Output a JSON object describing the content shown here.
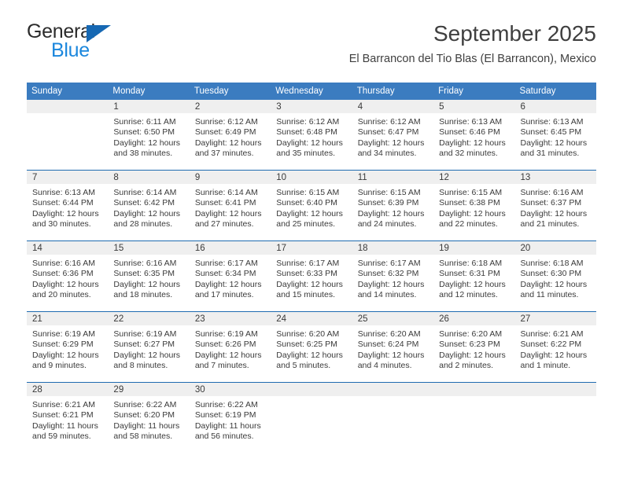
{
  "brand": {
    "line1": "General",
    "line2": "Blue",
    "triangle_color": "#1668b3",
    "blue_text_color": "#1b87dd"
  },
  "header": {
    "month_title": "September 2025",
    "location": "El Barrancon del Tio Blas (El Barrancon), Mexico"
  },
  "theme": {
    "header_blue": "#3b7cc0",
    "separator_blue": "#1f6bb0",
    "daynum_band": "#efefef",
    "text": "#3a3a3a"
  },
  "calendar": {
    "weekday_headers": [
      "Sunday",
      "Monday",
      "Tuesday",
      "Wednesday",
      "Thursday",
      "Friday",
      "Saturday"
    ],
    "weeks": [
      [
        {
          "day": "",
          "sunrise": "",
          "sunset": "",
          "daylight_line1": "",
          "daylight_line2": "",
          "blank": true
        },
        {
          "day": "1",
          "sunrise": "Sunrise: 6:11 AM",
          "sunset": "Sunset: 6:50 PM",
          "daylight_line1": "Daylight: 12 hours",
          "daylight_line2": "and 38 minutes.",
          "blank": false
        },
        {
          "day": "2",
          "sunrise": "Sunrise: 6:12 AM",
          "sunset": "Sunset: 6:49 PM",
          "daylight_line1": "Daylight: 12 hours",
          "daylight_line2": "and 37 minutes.",
          "blank": false
        },
        {
          "day": "3",
          "sunrise": "Sunrise: 6:12 AM",
          "sunset": "Sunset: 6:48 PM",
          "daylight_line1": "Daylight: 12 hours",
          "daylight_line2": "and 35 minutes.",
          "blank": false
        },
        {
          "day": "4",
          "sunrise": "Sunrise: 6:12 AM",
          "sunset": "Sunset: 6:47 PM",
          "daylight_line1": "Daylight: 12 hours",
          "daylight_line2": "and 34 minutes.",
          "blank": false
        },
        {
          "day": "5",
          "sunrise": "Sunrise: 6:13 AM",
          "sunset": "Sunset: 6:46 PM",
          "daylight_line1": "Daylight: 12 hours",
          "daylight_line2": "and 32 minutes.",
          "blank": false
        },
        {
          "day": "6",
          "sunrise": "Sunrise: 6:13 AM",
          "sunset": "Sunset: 6:45 PM",
          "daylight_line1": "Daylight: 12 hours",
          "daylight_line2": "and 31 minutes.",
          "blank": false
        }
      ],
      [
        {
          "day": "7",
          "sunrise": "Sunrise: 6:13 AM",
          "sunset": "Sunset: 6:44 PM",
          "daylight_line1": "Daylight: 12 hours",
          "daylight_line2": "and 30 minutes.",
          "blank": false
        },
        {
          "day": "8",
          "sunrise": "Sunrise: 6:14 AM",
          "sunset": "Sunset: 6:42 PM",
          "daylight_line1": "Daylight: 12 hours",
          "daylight_line2": "and 28 minutes.",
          "blank": false
        },
        {
          "day": "9",
          "sunrise": "Sunrise: 6:14 AM",
          "sunset": "Sunset: 6:41 PM",
          "daylight_line1": "Daylight: 12 hours",
          "daylight_line2": "and 27 minutes.",
          "blank": false
        },
        {
          "day": "10",
          "sunrise": "Sunrise: 6:15 AM",
          "sunset": "Sunset: 6:40 PM",
          "daylight_line1": "Daylight: 12 hours",
          "daylight_line2": "and 25 minutes.",
          "blank": false
        },
        {
          "day": "11",
          "sunrise": "Sunrise: 6:15 AM",
          "sunset": "Sunset: 6:39 PM",
          "daylight_line1": "Daylight: 12 hours",
          "daylight_line2": "and 24 minutes.",
          "blank": false
        },
        {
          "day": "12",
          "sunrise": "Sunrise: 6:15 AM",
          "sunset": "Sunset: 6:38 PM",
          "daylight_line1": "Daylight: 12 hours",
          "daylight_line2": "and 22 minutes.",
          "blank": false
        },
        {
          "day": "13",
          "sunrise": "Sunrise: 6:16 AM",
          "sunset": "Sunset: 6:37 PM",
          "daylight_line1": "Daylight: 12 hours",
          "daylight_line2": "and 21 minutes.",
          "blank": false
        }
      ],
      [
        {
          "day": "14",
          "sunrise": "Sunrise: 6:16 AM",
          "sunset": "Sunset: 6:36 PM",
          "daylight_line1": "Daylight: 12 hours",
          "daylight_line2": "and 20 minutes.",
          "blank": false
        },
        {
          "day": "15",
          "sunrise": "Sunrise: 6:16 AM",
          "sunset": "Sunset: 6:35 PM",
          "daylight_line1": "Daylight: 12 hours",
          "daylight_line2": "and 18 minutes.",
          "blank": false
        },
        {
          "day": "16",
          "sunrise": "Sunrise: 6:17 AM",
          "sunset": "Sunset: 6:34 PM",
          "daylight_line1": "Daylight: 12 hours",
          "daylight_line2": "and 17 minutes.",
          "blank": false
        },
        {
          "day": "17",
          "sunrise": "Sunrise: 6:17 AM",
          "sunset": "Sunset: 6:33 PM",
          "daylight_line1": "Daylight: 12 hours",
          "daylight_line2": "and 15 minutes.",
          "blank": false
        },
        {
          "day": "18",
          "sunrise": "Sunrise: 6:17 AM",
          "sunset": "Sunset: 6:32 PM",
          "daylight_line1": "Daylight: 12 hours",
          "daylight_line2": "and 14 minutes.",
          "blank": false
        },
        {
          "day": "19",
          "sunrise": "Sunrise: 6:18 AM",
          "sunset": "Sunset: 6:31 PM",
          "daylight_line1": "Daylight: 12 hours",
          "daylight_line2": "and 12 minutes.",
          "blank": false
        },
        {
          "day": "20",
          "sunrise": "Sunrise: 6:18 AM",
          "sunset": "Sunset: 6:30 PM",
          "daylight_line1": "Daylight: 12 hours",
          "daylight_line2": "and 11 minutes.",
          "blank": false
        }
      ],
      [
        {
          "day": "21",
          "sunrise": "Sunrise: 6:19 AM",
          "sunset": "Sunset: 6:29 PM",
          "daylight_line1": "Daylight: 12 hours",
          "daylight_line2": "and 9 minutes.",
          "blank": false
        },
        {
          "day": "22",
          "sunrise": "Sunrise: 6:19 AM",
          "sunset": "Sunset: 6:27 PM",
          "daylight_line1": "Daylight: 12 hours",
          "daylight_line2": "and 8 minutes.",
          "blank": false
        },
        {
          "day": "23",
          "sunrise": "Sunrise: 6:19 AM",
          "sunset": "Sunset: 6:26 PM",
          "daylight_line1": "Daylight: 12 hours",
          "daylight_line2": "and 7 minutes.",
          "blank": false
        },
        {
          "day": "24",
          "sunrise": "Sunrise: 6:20 AM",
          "sunset": "Sunset: 6:25 PM",
          "daylight_line1": "Daylight: 12 hours",
          "daylight_line2": "and 5 minutes.",
          "blank": false
        },
        {
          "day": "25",
          "sunrise": "Sunrise: 6:20 AM",
          "sunset": "Sunset: 6:24 PM",
          "daylight_line1": "Daylight: 12 hours",
          "daylight_line2": "and 4 minutes.",
          "blank": false
        },
        {
          "day": "26",
          "sunrise": "Sunrise: 6:20 AM",
          "sunset": "Sunset: 6:23 PM",
          "daylight_line1": "Daylight: 12 hours",
          "daylight_line2": "and 2 minutes.",
          "blank": false
        },
        {
          "day": "27",
          "sunrise": "Sunrise: 6:21 AM",
          "sunset": "Sunset: 6:22 PM",
          "daylight_line1": "Daylight: 12 hours",
          "daylight_line2": "and 1 minute.",
          "blank": false
        }
      ],
      [
        {
          "day": "28",
          "sunrise": "Sunrise: 6:21 AM",
          "sunset": "Sunset: 6:21 PM",
          "daylight_line1": "Daylight: 11 hours",
          "daylight_line2": "and 59 minutes.",
          "blank": false
        },
        {
          "day": "29",
          "sunrise": "Sunrise: 6:22 AM",
          "sunset": "Sunset: 6:20 PM",
          "daylight_line1": "Daylight: 11 hours",
          "daylight_line2": "and 58 minutes.",
          "blank": false
        },
        {
          "day": "30",
          "sunrise": "Sunrise: 6:22 AM",
          "sunset": "Sunset: 6:19 PM",
          "daylight_line1": "Daylight: 11 hours",
          "daylight_line2": "and 56 minutes.",
          "blank": false
        },
        {
          "day": "",
          "sunrise": "",
          "sunset": "",
          "daylight_line1": "",
          "daylight_line2": "",
          "blank": true
        },
        {
          "day": "",
          "sunrise": "",
          "sunset": "",
          "daylight_line1": "",
          "daylight_line2": "",
          "blank": true
        },
        {
          "day": "",
          "sunrise": "",
          "sunset": "",
          "daylight_line1": "",
          "daylight_line2": "",
          "blank": true
        },
        {
          "day": "",
          "sunrise": "",
          "sunset": "",
          "daylight_line1": "",
          "daylight_line2": "",
          "blank": true
        }
      ]
    ]
  }
}
